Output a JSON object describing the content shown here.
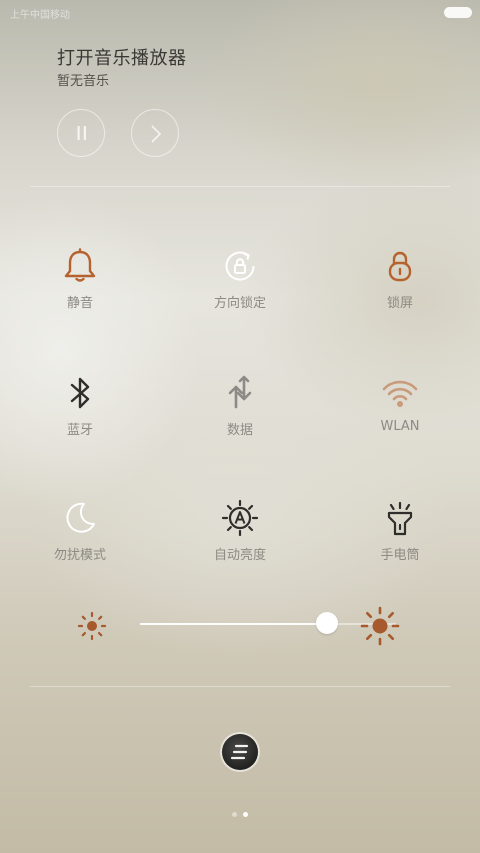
{
  "status_bar": {
    "carrier": "上午中国移动"
  },
  "music_player": {
    "title": "打开音乐播放器",
    "subtitle": "暂无音乐",
    "controls": [
      {
        "name": "pause-icon"
      },
      {
        "name": "chevron-right-icon"
      }
    ]
  },
  "toggles": [
    {
      "label": "静音",
      "icon": "bell-icon",
      "active": true,
      "color": "#b5622e"
    },
    {
      "label": "方向锁定",
      "icon": "rotation-lock-icon",
      "active": false,
      "color": "#ffffff"
    },
    {
      "label": "锁屏",
      "icon": "lock-icon",
      "active": true,
      "color": "#b5622e"
    },
    {
      "label": "蓝牙",
      "icon": "bluetooth-icon",
      "active": true,
      "color": "#2f2e2b"
    },
    {
      "label": "数据",
      "icon": "data-transfer-icon",
      "active": false,
      "color": "#8c8a85"
    },
    {
      "label": "WLAN",
      "icon": "wifi-icon",
      "active": false,
      "color": "#c99b7c"
    },
    {
      "label": "勿扰模式",
      "icon": "moon-icon",
      "active": false,
      "color": "#ffffff"
    },
    {
      "label": "自动亮度",
      "icon": "auto-brightness-icon",
      "active": true,
      "color": "#2f2e2b"
    },
    {
      "label": "手电筒",
      "icon": "flashlight-icon",
      "active": true,
      "color": "#2f2e2b"
    }
  ],
  "brightness": {
    "level": 0.73,
    "low_icon": "sun-low-icon",
    "high_icon": "sun-high-icon",
    "icon_color": "#a65a2e"
  },
  "bottom": {
    "edit_icon": "edit-toggles-icon",
    "pages": 2,
    "current_page": 2
  }
}
